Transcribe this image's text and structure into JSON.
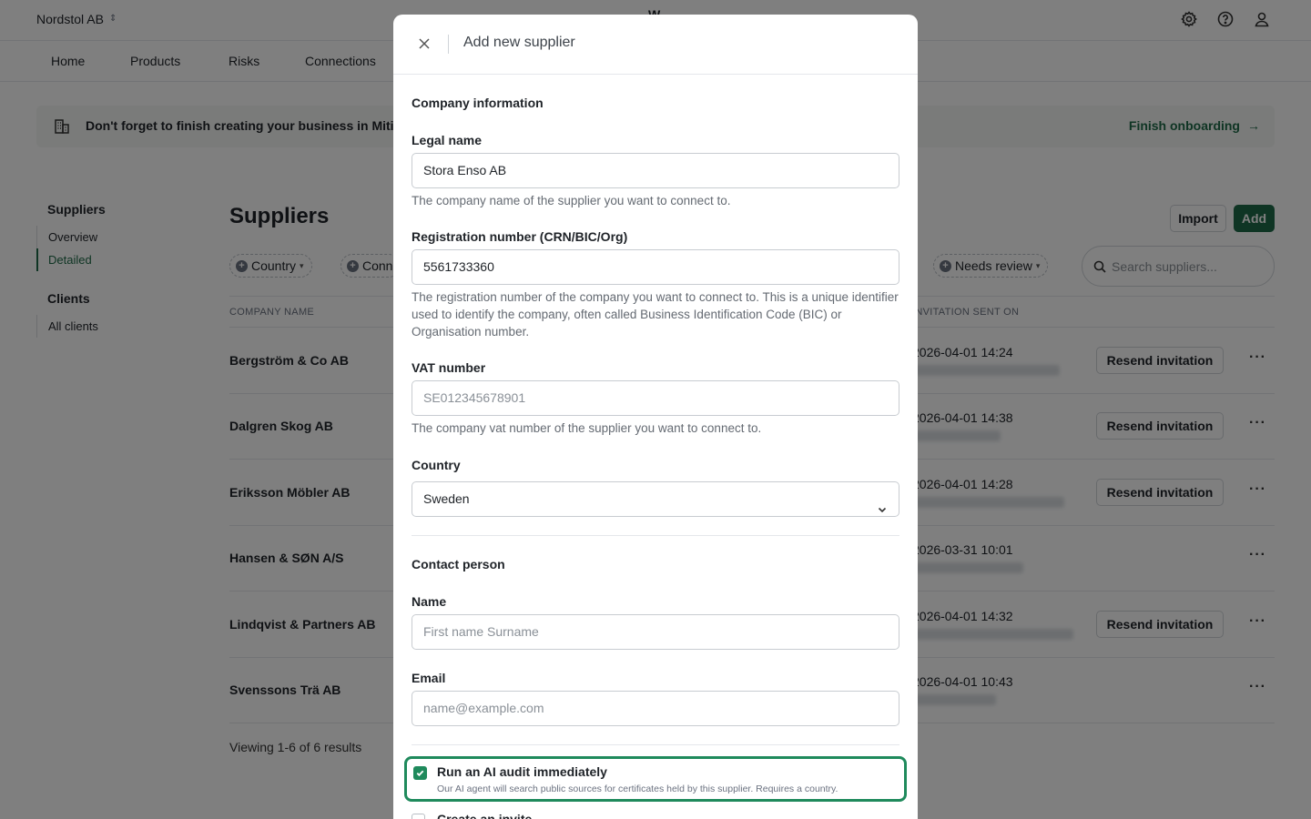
{
  "app": {
    "org_name": "Nordstol AB",
    "brand_mark": "W"
  },
  "nav": {
    "items": [
      "Home",
      "Products",
      "Risks",
      "Connections"
    ]
  },
  "banner": {
    "text": "Don't forget to finish creating your business in Miti",
    "link": "Finish onboarding",
    "link_arrow": "→"
  },
  "sidebar": {
    "groups": [
      {
        "title": "Suppliers",
        "items": [
          "Overview",
          "Detailed"
        ],
        "active": "Detailed"
      },
      {
        "title": "Clients",
        "items": [
          "All clients"
        ]
      }
    ]
  },
  "page": {
    "title": "Suppliers",
    "import_label": "Import",
    "add_label": "Add",
    "filters": [
      "Country",
      "Conn",
      "Needs review"
    ],
    "search_placeholder": "Search suppliers...",
    "columns": [
      "COMPANY NAME",
      "INVITATION SENT ON"
    ],
    "rows": [
      {
        "name": "Bergström & Co AB",
        "sent": "2026-04-01 14:24",
        "resend": "Resend invitation"
      },
      {
        "name": "Dalgren Skog AB",
        "sent": "2026-04-01 14:38",
        "resend": "Resend invitation"
      },
      {
        "name": "Eriksson Möbler AB",
        "sent": "2026-04-01 14:28",
        "resend": "Resend invitation"
      },
      {
        "name": "Hansen & SØN A/S",
        "sent": "2026-03-31 10:01",
        "resend": ""
      },
      {
        "name": "Lindqvist & Partners AB",
        "sent": "2026-04-01 14:32",
        "resend": "Resend invitation"
      },
      {
        "name": "Svenssons Trä AB",
        "sent": "2026-04-01 10:43",
        "resend": ""
      }
    ],
    "viewing": "Viewing 1-6 of 6 results"
  },
  "modal": {
    "title": "Add new supplier",
    "company_section": "Company information",
    "legal_name": {
      "label": "Legal name",
      "value": "Stora Enso AB",
      "help": "The company name of the supplier you want to connect to."
    },
    "registration": {
      "label": "Registration number (CRN/BIC/Org)",
      "value": "5561733360",
      "help": "The registration number of the company you want to connect to. This is a unique identifier used to identify the company, often called Business Identification Code (BIC) or Organisation number."
    },
    "vat": {
      "label": "VAT number",
      "placeholder": "SE012345678901",
      "help": "The company vat number of the supplier you want to connect to."
    },
    "country": {
      "label": "Country",
      "value": "Sweden"
    },
    "contact_section": "Contact person",
    "contact_name": {
      "label": "Name",
      "placeholder": "First name Surname"
    },
    "contact_email": {
      "label": "Email",
      "placeholder": "name@example.com"
    },
    "ai_audit": {
      "label": "Run an AI audit immediately",
      "help": "Our AI agent will search public sources for certificates held by this supplier. Requires a country.",
      "checked": true
    },
    "create_invite": {
      "label": "Create an invite",
      "checked": false
    }
  },
  "colors": {
    "accent": "#1f6b48",
    "checkbox": "#1f8a5c",
    "overlay": "rgba(0,0,0,0.5)"
  },
  "icons": [
    "chevron-updown-icon",
    "gear-icon",
    "help-circle-icon",
    "user-icon",
    "building-icon",
    "arrow-right-icon",
    "plus-circle-icon",
    "chevron-down-icon",
    "search-icon",
    "more-icon",
    "close-icon",
    "check-icon"
  ]
}
